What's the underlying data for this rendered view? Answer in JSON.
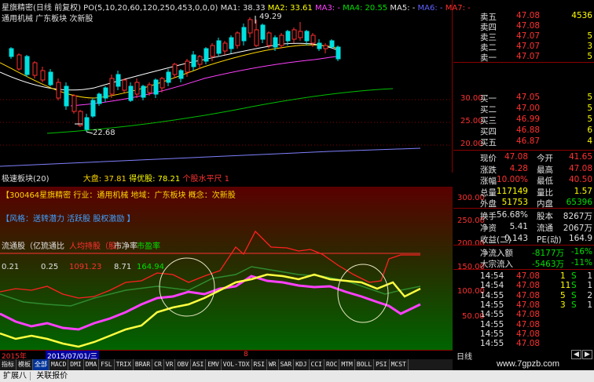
{
  "main": {
    "title": "星旗精密(日线 前复权)",
    "po": "PO(5,10,20,60,120,250,453,0,0,0)",
    "ma1": "MA1: 38.33",
    "ma2": "MA2: 33.61",
    "ma3": "MA3: -",
    "ma4": "MA4: 20.55",
    "ma5": "MA5: -",
    "ma6": "MA6: -",
    "ma7": "MA7: -",
    "tags": "通用机械 广东板块 次新股",
    "high_label": "49.29",
    "low_label": "22.68"
  },
  "price_axis": [
    "30.00",
    "25.00",
    "20.00"
  ],
  "indicator": {
    "name": "极速板块(20)",
    "dapan": "大盘: 37.81",
    "gegu": " 得优股: 78.21",
    "sub": "个股水平尺 1",
    "info_line": "【300464星旗精密 行业：通用机械 地域：广东板块 概念：次新股",
    "style_line": "【风格：送转潜力 活跃股 股权激励 】",
    "col_headers": [
      "流通股（亿）",
      "流通比",
      "人均持股（股）",
      "市净率",
      "市盈率"
    ],
    "col_values": [
      "0.21",
      "0.25",
      "1091.23",
      "8.71",
      "164.94"
    ],
    "axis": [
      "300.00",
      "250.00",
      "200.00",
      "150.00",
      "100.00",
      "50.00"
    ]
  },
  "quote": {
    "sell": [
      {
        "label": "卖五",
        "price": "47.08",
        "vol": "4536"
      },
      {
        "label": "卖四",
        "price": "47.08",
        "vol": ""
      },
      {
        "label": "卖三",
        "price": "47.07",
        "vol": "5"
      },
      {
        "label": "卖二",
        "price": "47.07",
        "vol": "3"
      },
      {
        "label": "卖一",
        "price": "47.07",
        "vol": "5"
      }
    ],
    "buy": [
      {
        "label": "买一",
        "price": "47.05",
        "vol": "5"
      },
      {
        "label": "买二",
        "price": "47.00",
        "vol": "5"
      },
      {
        "label": "买三",
        "price": "46.99",
        "vol": "5"
      },
      {
        "label": "买四",
        "price": "46.88",
        "vol": "6"
      },
      {
        "label": "买五",
        "price": "46.87",
        "vol": "4"
      }
    ],
    "stats": [
      {
        "l1": "现价",
        "v1": "47.08",
        "l2": "今开",
        "v2": "41.65"
      },
      {
        "l1": "涨跌",
        "v1": "4.28",
        "l2": "最高",
        "v2": "47.08"
      },
      {
        "l1": "涨幅",
        "v1": "10.00%",
        "l2": "最低",
        "v2": "40.50"
      },
      {
        "l1": "总量",
        "v1": "117149",
        "l2": "量比",
        "v2": "1.57"
      },
      {
        "l1": "外盘",
        "v1": "51753",
        "l2": "内盘",
        "v2": "65396"
      }
    ],
    "stats2": [
      {
        "l1": "换手",
        "v1": "56.68%",
        "l2": "股本",
        "v2": "8267万"
      },
      {
        "l1": "净资",
        "v1": "5.41",
        "l2": "流通",
        "v2": "2067万"
      },
      {
        "l1": "收益(二)",
        "v1": "0.143",
        "l2": "PE(动)",
        "v2": "164.9"
      }
    ],
    "flow": [
      {
        "l": "净流入额",
        "v": "-8177万",
        "p": "-16%"
      },
      {
        "l": "大宗流入",
        "v": "-5463万",
        "p": "-11%"
      }
    ],
    "ticks": [
      {
        "t": "14:54",
        "p": "47.08",
        "v": "1",
        "s": "S",
        "n": "1"
      },
      {
        "t": "14:54",
        "p": "47.08",
        "v": "11",
        "s": "S",
        "n": "1"
      },
      {
        "t": "14:55",
        "p": "47.08",
        "v": "5",
        "s": "S",
        "n": "2"
      },
      {
        "t": "14:55",
        "p": "47.08",
        "v": "3",
        "s": "S",
        "n": "1"
      },
      {
        "t": "14:55",
        "p": "47.08",
        "v": "",
        "s": "",
        "n": ""
      },
      {
        "t": "14:55",
        "p": "47.08",
        "v": "",
        "s": "",
        "n": ""
      },
      {
        "t": "14:55",
        "p": "47.08",
        "v": "",
        "s": "",
        "n": ""
      },
      {
        "t": "14:55",
        "p": "47.08",
        "v": "",
        "s": "",
        "n": ""
      }
    ]
  },
  "timeline": {
    "year": "2015年",
    "date": "2015/07/01/三",
    "mark": "8"
  },
  "tabs": [
    "指标",
    "模板",
    "全部",
    "MACD",
    "DMI",
    "DMA",
    "FSL",
    "TRIX",
    "BRAR",
    "CR",
    "VR",
    "OBV",
    "ASI",
    "EMV",
    "VOL-TDX",
    "RSI",
    "WR",
    "SAR",
    "KDJ",
    "CCI",
    "ROC",
    "MTM",
    "BOLL",
    "PSI",
    "MCST"
  ],
  "right_bottom": {
    "label": "日线"
  },
  "watermark": "www.7gpzb.com",
  "status": [
    "扩展八",
    "关联报价"
  ]
}
